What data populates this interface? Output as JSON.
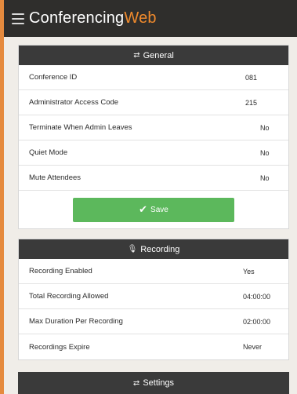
{
  "app": {
    "name_main": "Conferencing",
    "name_accent": "Web"
  },
  "general": {
    "title": "General",
    "rows": [
      {
        "label": "Conference ID",
        "value": "081"
      },
      {
        "label": "Administrator Access Code",
        "value": "215"
      },
      {
        "label": "Terminate When Admin Leaves",
        "value": "No"
      },
      {
        "label": "Quiet Mode",
        "value": "No"
      },
      {
        "label": "Mute Attendees",
        "value": "No"
      }
    ],
    "save_label": "Save"
  },
  "recording": {
    "title": "Recording",
    "rows": [
      {
        "label": "Recording Enabled",
        "value": "Yes"
      },
      {
        "label": "Total Recording Allowed",
        "value": "04:00:00"
      },
      {
        "label": "Max Duration Per Recording",
        "value": "02:00:00"
      },
      {
        "label": "Recordings Expire",
        "value": "Never"
      }
    ]
  },
  "settings": {
    "title": "Settings"
  },
  "colors": {
    "accent": "#f08a2c",
    "header_bg": "#3a3a3a",
    "save_button": "#5cb85c"
  },
  "icons": {
    "menu": "hamburger-menu-icon",
    "general": "sliders-icon",
    "recording": "microphone-icon",
    "settings": "sliders-icon",
    "save": "checkmark-icon"
  }
}
